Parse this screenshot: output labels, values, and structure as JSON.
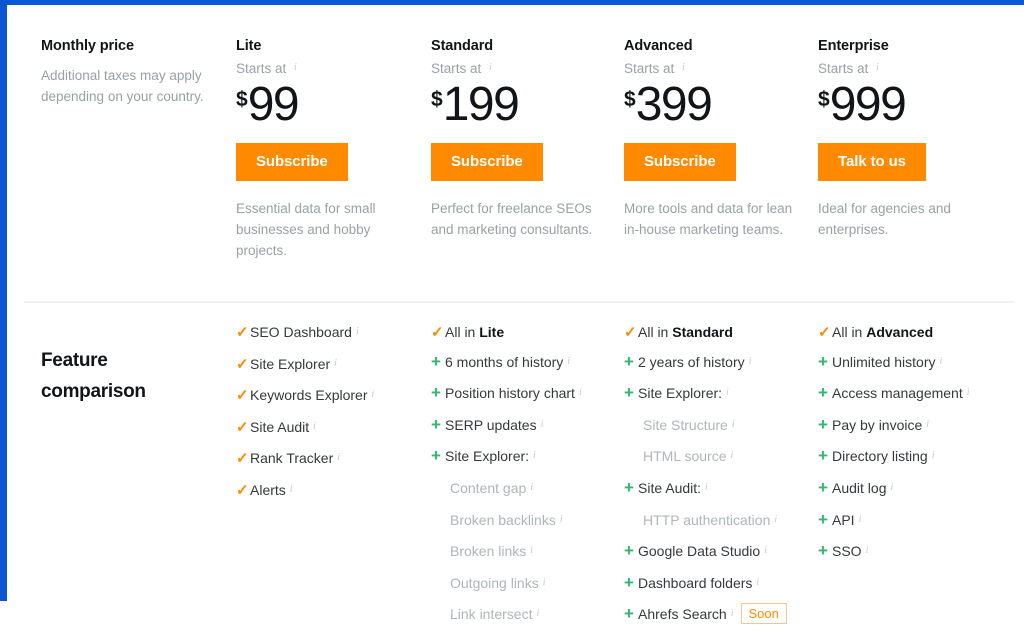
{
  "theme": {
    "accent_blue": "#0b57d0",
    "orange": "#ff8a00",
    "green": "#2eb872",
    "muted": "#9aa0a6"
  },
  "pricing": {
    "label_title": "Monthly price",
    "label_desc": "Additional taxes may apply depending on your country.",
    "starts_at": "Starts at",
    "info_icon": "info-icon",
    "currency": "$",
    "plans": [
      {
        "name": "Lite",
        "price": "99",
        "cta": "Subscribe",
        "desc": "Essential data for small businesses and hobby projects."
      },
      {
        "name": "Standard",
        "price": "199",
        "cta": "Subscribe",
        "desc": "Perfect for freelance SEOs and marketing consultants."
      },
      {
        "name": "Advanced",
        "price": "399",
        "cta": "Subscribe",
        "desc": "More tools and data for lean in-house marketing teams."
      },
      {
        "name": "Enterprise",
        "price": "999",
        "cta": "Talk to us",
        "desc": "Ideal for agencies and enterprises."
      }
    ]
  },
  "features": {
    "title": "Feature comparison",
    "columns": [
      {
        "plan": "Lite",
        "items": [
          {
            "mark": "check",
            "text": "SEO Dashboard",
            "info": true
          },
          {
            "mark": "check",
            "text": "Site Explorer",
            "info": true
          },
          {
            "mark": "check",
            "text": "Keywords Explorer",
            "info": true
          },
          {
            "mark": "check",
            "text": "Site Audit",
            "info": true
          },
          {
            "mark": "check",
            "text": "Rank Tracker",
            "info": true
          },
          {
            "mark": "check",
            "text": "Alerts",
            "info": true
          }
        ]
      },
      {
        "plan": "Standard",
        "items": [
          {
            "mark": "check",
            "text": "All in ",
            "strong": "Lite",
            "info": false
          },
          {
            "mark": "plus",
            "text": "6 months of history",
            "info": true
          },
          {
            "mark": "plus",
            "text": "Position history chart",
            "info": true
          },
          {
            "mark": "plus",
            "text": "SERP updates",
            "info": true
          },
          {
            "mark": "plus",
            "text": "Site Explorer:",
            "info": true
          },
          {
            "mark": "none",
            "sub": true,
            "text": "Content gap",
            "info": true
          },
          {
            "mark": "none",
            "sub": true,
            "text": "Broken backlinks",
            "info": true
          },
          {
            "mark": "none",
            "sub": true,
            "text": "Broken links",
            "info": true
          },
          {
            "mark": "none",
            "sub": true,
            "text": "Outgoing links",
            "info": true
          },
          {
            "mark": "none",
            "sub": true,
            "text": "Link intersect",
            "info": true
          }
        ]
      },
      {
        "plan": "Advanced",
        "items": [
          {
            "mark": "check",
            "text": "All in ",
            "strong": "Standard",
            "info": false
          },
          {
            "mark": "plus",
            "text": "2 years of history",
            "info": true
          },
          {
            "mark": "plus",
            "text": "Site Explorer:",
            "info": true
          },
          {
            "mark": "none",
            "sub": true,
            "text": "Site Structure",
            "info": true
          },
          {
            "mark": "none",
            "sub": true,
            "text": "HTML source",
            "info": true
          },
          {
            "mark": "plus",
            "text": "Site Audit:",
            "info": true
          },
          {
            "mark": "none",
            "sub": true,
            "text": "HTTP authentication",
            "info": true
          },
          {
            "mark": "plus",
            "text": "Google Data Studio",
            "info": true
          },
          {
            "mark": "plus",
            "text": "Dashboard folders",
            "info": true
          },
          {
            "mark": "plus",
            "text": "Ahrefs Search",
            "info": true,
            "badge": "Soon"
          }
        ]
      },
      {
        "plan": "Enterprise",
        "items": [
          {
            "mark": "check",
            "text": "All in ",
            "strong": "Advanced",
            "info": false
          },
          {
            "mark": "plus",
            "text": "Unlimited history",
            "info": true
          },
          {
            "mark": "plus",
            "text": "Access management",
            "info": true
          },
          {
            "mark": "plus",
            "text": "Pay by invoice",
            "info": true
          },
          {
            "mark": "plus",
            "text": "Directory listing",
            "info": true
          },
          {
            "mark": "plus",
            "text": "Audit log",
            "info": true
          },
          {
            "mark": "plus",
            "text": "API",
            "info": true
          },
          {
            "mark": "plus",
            "text": "SSO",
            "info": true
          }
        ]
      }
    ]
  }
}
